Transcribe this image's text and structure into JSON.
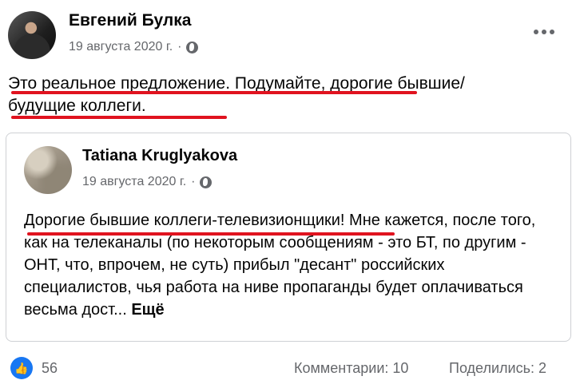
{
  "post": {
    "author": "Евгений Булка",
    "date": "19 августа 2020 г.",
    "separator": "·",
    "text": "Это реальное предложение. Подумайте, дорогие бывшие/будущие коллеги."
  },
  "shared_post": {
    "author": "Tatiana Kruglyakova",
    "date": "19 августа 2020 г.",
    "separator": "·",
    "text": "Дорогие бывшие коллеги-телевизионщики! Мне кажется, после того, как на телеканалы (по некоторым сообщениям - это БТ, по другим - ОНТ, что, впрочем, не суть) прибыл \"десант\" российских специалистов, чья работа на ниве пропаганды будет оплачиваться весьма дост...",
    "see_more_label": "Ещё"
  },
  "footer": {
    "reactions_count": "56",
    "comments_label": "Комментарии: 10",
    "shares_label": "Поделились: 2"
  },
  "colors": {
    "highlight_underline": "#e0131f",
    "like_blue": "#1877f2",
    "meta_gray": "#65676b"
  }
}
